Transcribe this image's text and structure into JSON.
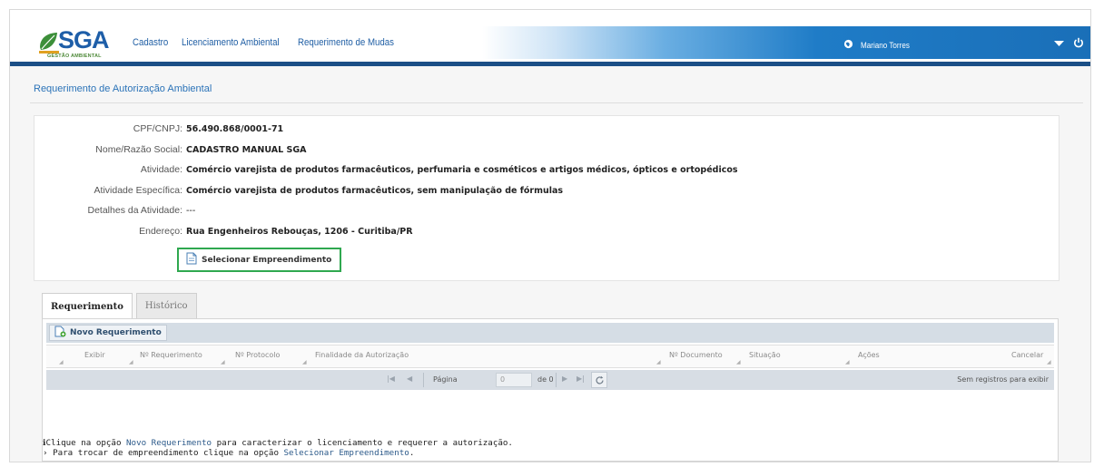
{
  "app": {
    "logo_text": "SGA",
    "logo_subtitle": "GESTÃO AMBIENTAL"
  },
  "nav": {
    "items": [
      {
        "label": "Cadastro"
      },
      {
        "label": "Licenciamento Ambiental"
      },
      {
        "label": "Requerimento de Mudas"
      }
    ]
  },
  "user": {
    "name": "Mariano Torres"
  },
  "page": {
    "title": "Requerimento de Autorização Ambiental"
  },
  "info": {
    "rows": [
      {
        "label": "CPF/CNPJ:",
        "value": "56.490.868/0001-71"
      },
      {
        "label": "Nome/Razão Social:",
        "value": "CADASTRO MANUAL SGA"
      },
      {
        "label": "Atividade:",
        "value": "Comércio varejista de produtos farmacêuticos, perfumaria e cosméticos e artigos médicos, ópticos e ortopédicos"
      },
      {
        "label": "Atividade Específica:",
        "value": "Comércio varejista de produtos farmacêuticos, sem manipulação de fórmulas"
      },
      {
        "label": "Detalhes da Atividade:",
        "value": "---"
      },
      {
        "label": "Endereço:",
        "value": "Rua Engenheiros Rebouças, 1206 - Curitiba/PR"
      }
    ],
    "select_button": "Selecionar Empreendimento"
  },
  "tabs": [
    {
      "label": "Requerimento",
      "active": true
    },
    {
      "label": "Histórico",
      "active": false
    }
  ],
  "grid": {
    "new_button": "Novo Requerimento",
    "columns": [
      "Exibir",
      "Nº Requerimento",
      "Nº Protocolo",
      "Finalidade da Autorização",
      "Nº Documento",
      "Situação",
      "Ações",
      "Cancelar"
    ],
    "pager": {
      "page_label": "Página",
      "page_value": "0",
      "of_label": "de 0",
      "empty_text": "Sem registros para exibir"
    }
  },
  "help": {
    "line1_prefix": "Clique na opção ",
    "line1_highlight": "Novo Requerimento",
    "line1_suffix": " para caracterizar o licenciamento e requerer a autorização.",
    "line2_prefix": "› Para trocar de empreendimento clique na opção ",
    "line2_highlight": "Selecionar Empreendimento",
    "line2_suffix": "."
  },
  "colors": {
    "brand_blue": "#1e5ea8",
    "header_bar": "#1b4f86",
    "link_blue": "#2b73b8",
    "highlight_green": "#2fa84f"
  },
  "icons": [
    "logo-leaf-icon",
    "globe-icon",
    "dropdown-caret-icon",
    "power-icon",
    "document-icon",
    "new-document-icon",
    "first-page-icon",
    "prev-page-icon",
    "next-page-icon",
    "last-page-icon",
    "refresh-icon"
  ]
}
